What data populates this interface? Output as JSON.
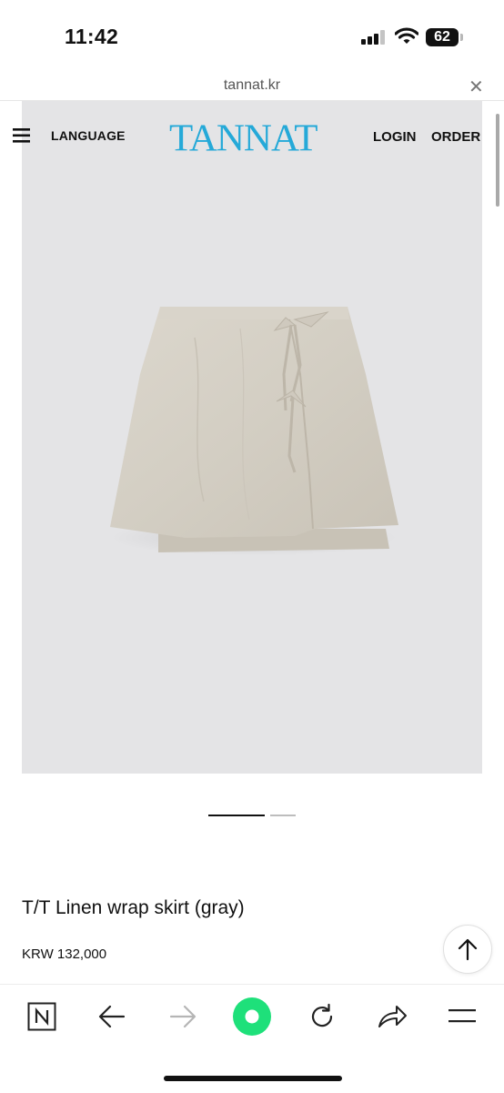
{
  "status_bar": {
    "time": "11:42",
    "battery": "62"
  },
  "browser": {
    "url": "tannat.kr"
  },
  "header": {
    "language_label": "LANGUAGE",
    "logo_text": "TANNAT",
    "login_label": "LOGIN",
    "order_label": "ORDER"
  },
  "product": {
    "title": "T/T Linen wrap skirt (gray)",
    "price": "KRW 132,000",
    "image_slide_count": 2,
    "active_slide": 1
  },
  "toolbar": {
    "items": [
      "naver-home",
      "back",
      "forward",
      "green-dot",
      "refresh",
      "share",
      "menu"
    ]
  },
  "colors": {
    "logo": "#25a9d8",
    "hero_bg": "#e4e4e6",
    "skirt": "#d6d1c7",
    "green_button": "#1ee07a"
  }
}
